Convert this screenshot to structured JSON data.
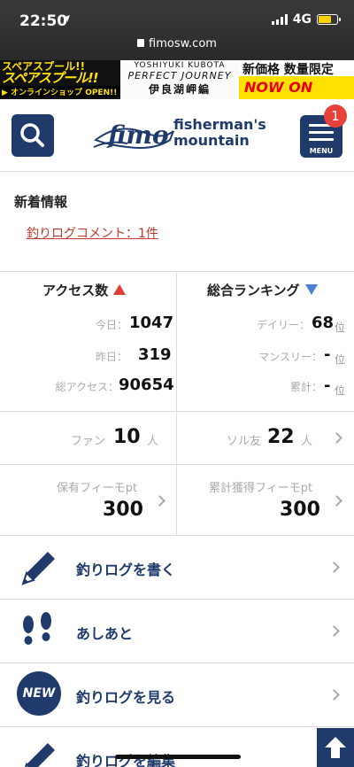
{
  "status": {
    "time": "22:50",
    "network": "4G"
  },
  "browser": {
    "url": "fimosw.com"
  },
  "banners": {
    "b1_top": "スペアスプール!!",
    "b1_mid": "スペアスプール!!",
    "b1_bot": "▶ オンラインショップ OPEN!!",
    "b2_a": "YOSHIYUKI KUBOTA",
    "b2_b": "PERFECT JOURNEY",
    "b2_c": "伊良湖岬編",
    "b3_top": "新価格 数量限定",
    "b3_bot": "NOW ON SALE"
  },
  "header": {
    "logo_fimo": "fimo",
    "logo_line1": "fisherman's",
    "logo_line2": "mountain",
    "menu_label": "MENU",
    "menu_badge": "1"
  },
  "news": {
    "title": "新着情報",
    "link": "釣りログコメント：1件"
  },
  "access": {
    "title": "アクセス数",
    "today_label": "今日：",
    "today": "1047",
    "yesterday_label": "昨日：",
    "yesterday": "319",
    "total_label": "総アクセス：",
    "total": "90654"
  },
  "ranking": {
    "title": "総合ランキング",
    "daily_label": "デイリー：",
    "daily": "68",
    "monthly_label": "マンスリー：",
    "monthly": "-",
    "cumulative_label": "累計：",
    "cumulative": "-",
    "unit": "位"
  },
  "social": {
    "fan_label": "ファン",
    "fan": "10",
    "fan_unit": "人",
    "friend_label": "ソル友",
    "friend": "22",
    "friend_unit": "人"
  },
  "points": {
    "held_label": "保有フィーモpt",
    "held": "300",
    "earned_label": "累計獲得フィーモpt",
    "earned": "300"
  },
  "menu": {
    "write_log": "釣りログを書く",
    "footprints": "あしあと",
    "new_badge": "NEW",
    "view_log": "釣りログを見る",
    "edit_log": "釣りログを編集"
  }
}
